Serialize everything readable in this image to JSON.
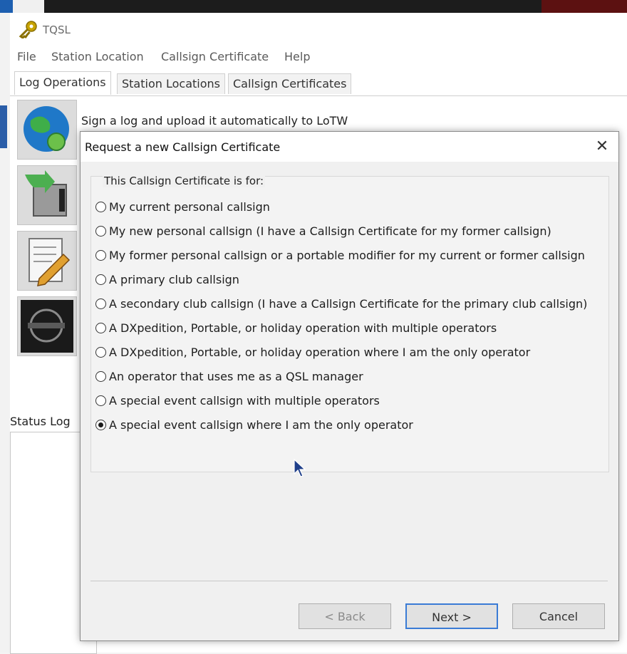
{
  "app": {
    "title": "TQSL"
  },
  "menu": [
    "File",
    "Station Location",
    "Callsign Certificate",
    "Help"
  ],
  "tabs": [
    "Log Operations",
    "Station Locations",
    "Callsign Certificates"
  ],
  "operations": {
    "sign_upload": "Sign a log and upload it automatically to LoTW"
  },
  "status": {
    "label": "Status Log"
  },
  "dialog": {
    "title": "Request a new Callsign Certificate",
    "group_caption": "This Callsign Certificate is for:",
    "options": [
      "My current personal callsign",
      "My new personal callsign (I have a Callsign Certificate for my former callsign)",
      "My former personal callsign or a portable modifier for my current or former callsign",
      "A primary club callsign",
      "A secondary club callsign (I have a Callsign Certificate for the primary club callsign)",
      "A DXpedition, Portable, or holiday operation with multiple operators",
      "A DXpedition, Portable, or holiday operation where I am the only operator",
      "An operator that uses me as a QSL manager",
      "A special event callsign with multiple operators",
      "A special event callsign where I am the only operator"
    ],
    "selected_index": 9,
    "buttons": {
      "back": "< Back",
      "next": "Next >",
      "cancel": "Cancel"
    },
    "close_glyph": "✕"
  }
}
